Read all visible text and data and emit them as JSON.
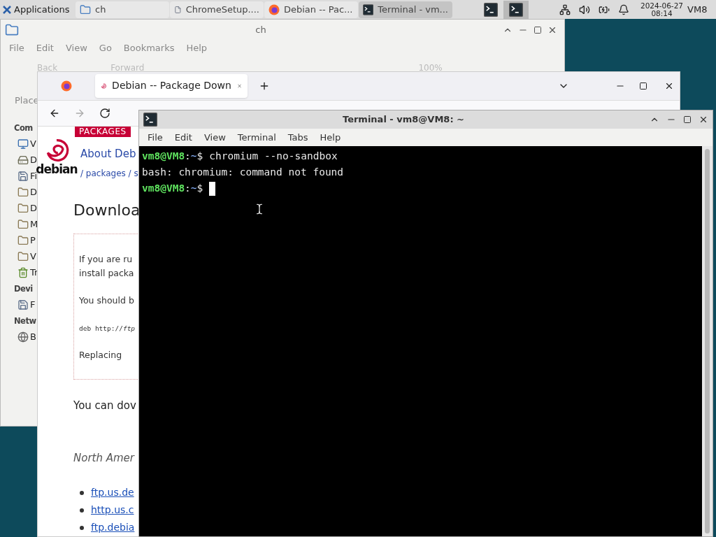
{
  "taskbar": {
    "menu_label": "Applications",
    "tasks": [
      {
        "label": "ch",
        "kind": "folder",
        "selected": false
      },
      {
        "label": "ChromeSetup....",
        "kind": "file",
        "selected": false
      },
      {
        "label": "Debian -- Pac...",
        "kind": "browser",
        "selected": false
      },
      {
        "label": "Terminal - vm...",
        "kind": "terminal",
        "selected": true
      }
    ],
    "launchers": [
      {
        "selected": false
      },
      {
        "selected": true
      }
    ],
    "date": "2024-06-27",
    "time": "08:14",
    "user": "VM8"
  },
  "file_manager": {
    "title": "ch",
    "menu": [
      "File",
      "Edit",
      "View",
      "Go",
      "Bookmarks",
      "Help"
    ],
    "toolbar": [
      "Back",
      "Forward",
      "100%"
    ],
    "places_label": "Place",
    "sections": [
      {
        "heading": "Com",
        "items": [
          {
            "label": "V",
            "kind": "desktop"
          },
          {
            "label": "D",
            "kind": "drive"
          },
          {
            "label": "Fi",
            "kind": "disk"
          },
          {
            "label": "D",
            "kind": "folder"
          },
          {
            "label": "D",
            "kind": "folder"
          },
          {
            "label": "M",
            "kind": "folder"
          },
          {
            "label": "P",
            "kind": "folder"
          },
          {
            "label": "V",
            "kind": "folder"
          },
          {
            "label": "Tr",
            "kind": "trash"
          }
        ]
      },
      {
        "heading": "Devi",
        "items": [
          {
            "label": "F",
            "kind": "disk"
          }
        ]
      },
      {
        "heading": "Netw",
        "items": [
          {
            "label": "B",
            "kind": "network"
          }
        ]
      }
    ]
  },
  "browser": {
    "tab": {
      "label": "Debian -- Package Down",
      "selected": true
    },
    "site_badge": "PACKAGES",
    "logo_text": "debian",
    "nav_link": "About Deb",
    "breadcrumb": "/ packages / s",
    "heading": "Downloa",
    "notice": [
      "If you are ru",
      "install packa",
      "You should b"
    ],
    "code_line": "deb http://*ftp*",
    "replacing": "Replacing",
    "download_text": "You can dov",
    "region": "North Amer",
    "mirrors": [
      "ftp.us.de",
      "http.us.c",
      "ftp.debia"
    ]
  },
  "terminal": {
    "title": "Terminal - vm8@VM8: ~",
    "menu": [
      "File",
      "Edit",
      "View",
      "Terminal",
      "Tabs",
      "Help"
    ],
    "lines": [
      {
        "kind": "prompt",
        "user": "vm8@VM8",
        "separator": ":",
        "path": "~",
        "sign": "$",
        "command": "chromium --no-sandbox"
      },
      {
        "kind": "output",
        "text": "bash: chromium: command not found"
      },
      {
        "kind": "prompt",
        "user": "vm8@VM8",
        "separator": ":",
        "path": "~",
        "sign": "$",
        "cursor": true
      }
    ]
  }
}
